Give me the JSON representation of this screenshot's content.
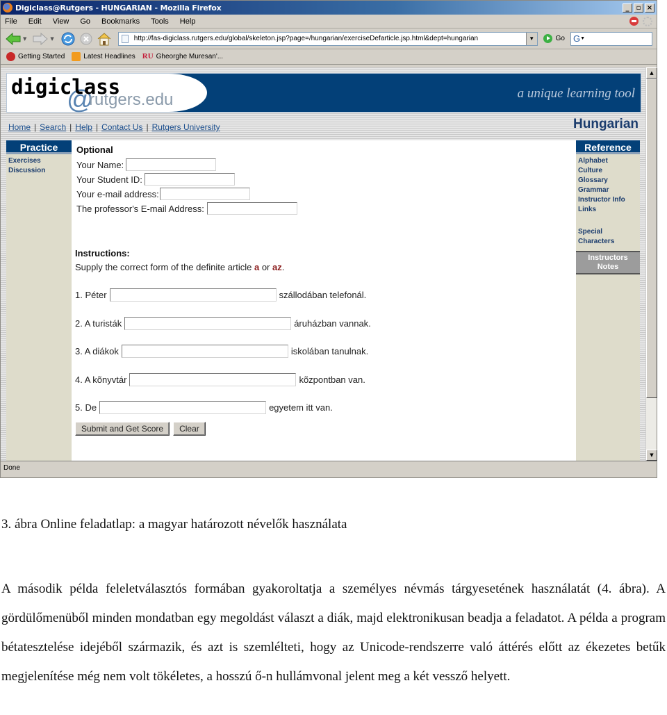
{
  "window": {
    "title": "Digiclass@Rutgers - HUNGARIAN - Mozilla Firefox",
    "controls": {
      "minimize": "_",
      "restore": "▫",
      "close": "×"
    }
  },
  "menu": {
    "items": [
      {
        "label": "File",
        "accel": "F"
      },
      {
        "label": "Edit",
        "accel": "E"
      },
      {
        "label": "View",
        "accel": "V"
      },
      {
        "label": "Go",
        "accel": "G"
      },
      {
        "label": "Bookmarks",
        "accel": "B"
      },
      {
        "label": "Tools",
        "accel": "T"
      },
      {
        "label": "Help",
        "accel": "H"
      }
    ]
  },
  "navbar": {
    "url": "http://fas-digiclass.rutgers.edu/global/skeleton.jsp?page=/hungarian/exerciseDefarticle.jsp.html&dept=hungarian",
    "go_label": "Go",
    "search_engine_glyph": "G"
  },
  "bookmarks": [
    {
      "label": "Getting Started",
      "icon": "firefox-icon"
    },
    {
      "label": "Latest Headlines",
      "icon": "rss-icon"
    },
    {
      "label": "Gheorghe Muresan'...",
      "icon": "ru-icon",
      "icon_text": "RU"
    }
  ],
  "site": {
    "logo_main": "digiclass",
    "logo_at": "@",
    "logo_domain": "rutgers.edu",
    "tagline": "a unique learning tool",
    "language": "Hungarian",
    "top_links": [
      "Home",
      "Search",
      "Help",
      "Contact Us",
      "Rutgers University"
    ],
    "separator": "|",
    "colors": {
      "banner": "#034078",
      "sidebar": "#dedccb",
      "link": "#1c3d6e",
      "article_highlight": "#8b1c1c"
    }
  },
  "left_sidebar": {
    "heading": "Practice",
    "links": [
      "Exercises",
      "Discussion"
    ]
  },
  "right_sidebar": {
    "heading": "Reference",
    "links": [
      "Alphabet",
      "Culture",
      "Glossary",
      "Grammar",
      "Instructor Info",
      "Links"
    ],
    "links2": [
      "Special",
      "Characters"
    ],
    "notes_line1": "Instructors",
    "notes_line2": "Notes"
  },
  "form": {
    "optional_heading": "Optional",
    "fields": [
      {
        "label": "Your Name:",
        "value": ""
      },
      {
        "label": "Your Student ID:",
        "value": ""
      },
      {
        "label": "Your e-mail address:",
        "value": ""
      },
      {
        "label": "The professor's E-mail Address:",
        "value": ""
      }
    ],
    "instructions_heading": "Instructions:",
    "instructions_pre": "Supply the correct form of the definite article ",
    "article_a": "a",
    "instructions_or": " or ",
    "article_az": "az",
    "instructions_end": ".",
    "questions": [
      {
        "prefix": "1. Péter",
        "suffix": "szállodában telefonál.",
        "value": ""
      },
      {
        "prefix": "2. A turisták",
        "suffix": "áruházban vannak.",
        "value": ""
      },
      {
        "prefix": "3. A diákok",
        "suffix": "iskolában tanulnak.",
        "value": ""
      },
      {
        "prefix": "4. A kõnyvtár",
        "suffix": "kõzpontban van.",
        "value": ""
      },
      {
        "prefix": "5. De",
        "suffix": "egyetem itt van.",
        "value": ""
      }
    ],
    "submit_label": "Submit and Get Score",
    "clear_label": "Clear"
  },
  "status": {
    "text": "Done"
  },
  "document": {
    "caption": "3. ábra Online feladatlap: a magyar határozott névelők használata",
    "paragraph": "A második példa feleletválasztós formában gyakoroltatja a személyes névmás tárgyesetének használatát (4. ábra). A gördülőmenüből minden mondatban egy megoldást választ a diák, majd elektronikusan beadja a feladatot. A példa a program bétatesztelése idejéből származik, és azt is szemlélteti, hogy az Unicode-rendszerre való áttérés előtt az ékezetes betűk megjelenítése még nem volt tökéletes, a hosszú ő-n hullámvonal jelent meg a két vessző helyett."
  }
}
